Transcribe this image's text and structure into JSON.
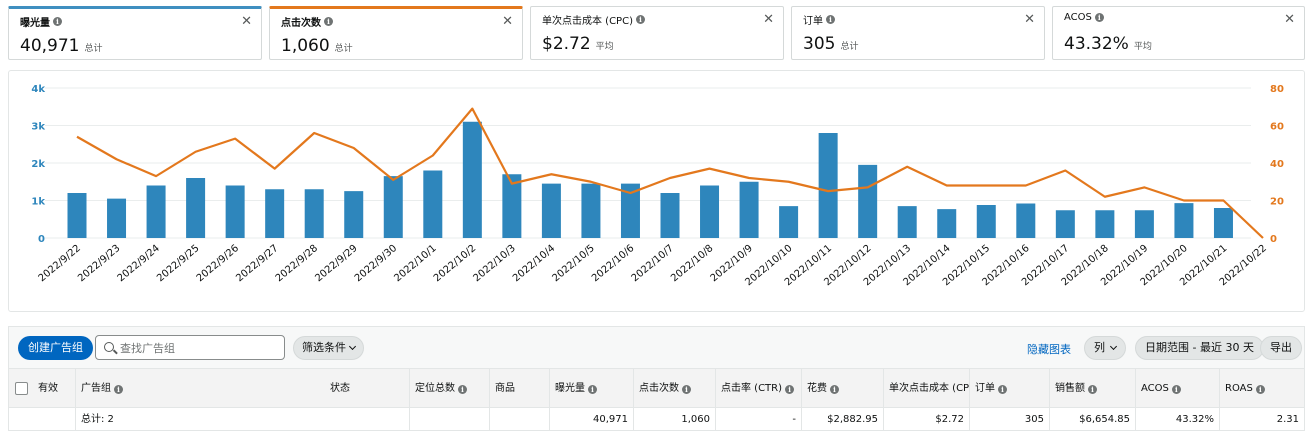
{
  "metric_cards": [
    {
      "title": "曝光量",
      "value": "40,971",
      "sub": "总计",
      "accent": "#3f8fc0"
    },
    {
      "title": "点击次数",
      "value": "1,060",
      "sub": "总计",
      "accent": "#e3781d"
    },
    {
      "title": "单次点击成本 (CPC)",
      "value": "$2.72",
      "sub": "平均"
    },
    {
      "title": "订单",
      "value": "305",
      "sub": "总计"
    },
    {
      "title": "ACOS",
      "value": "43.32%",
      "sub": "平均"
    }
  ],
  "chart_data": {
    "type": "bar",
    "categories": [
      "2022/9/22",
      "2022/9/23",
      "2022/9/24",
      "2022/9/25",
      "2022/9/26",
      "2022/9/27",
      "2022/9/28",
      "2022/9/29",
      "2022/9/30",
      "2022/10/1",
      "2022/10/2",
      "2022/10/3",
      "2022/10/4",
      "2022/10/5",
      "2022/10/6",
      "2022/10/7",
      "2022/10/8",
      "2022/10/9",
      "2022/10/10",
      "2022/10/11",
      "2022/10/12",
      "2022/10/13",
      "2022/10/14",
      "2022/10/15",
      "2022/10/16",
      "2022/10/17",
      "2022/10/18",
      "2022/10/19",
      "2022/10/20",
      "2022/10/21",
      "2022/10/22"
    ],
    "series": [
      {
        "axis": "left",
        "kind": "bar",
        "color": "#2e86bc",
        "values": [
          1200,
          1050,
          1400,
          1600,
          1400,
          1300,
          1300,
          1250,
          1650,
          1800,
          3100,
          1700,
          1450,
          1450,
          1450,
          1200,
          1400,
          1500,
          850,
          2800,
          1950,
          850,
          770,
          880,
          920,
          740,
          740,
          740,
          930,
          800,
          null
        ]
      },
      {
        "axis": "right",
        "kind": "line",
        "color": "#e3781d",
        "values": [
          54,
          42,
          33,
          46,
          53,
          37,
          56,
          48,
          31,
          44,
          69,
          29,
          34,
          30,
          24,
          32,
          37,
          32,
          30,
          25,
          27,
          38,
          28,
          28,
          28,
          36,
          22,
          27,
          20,
          20,
          0
        ]
      }
    ],
    "y_left": {
      "min": 0,
      "max": 4000,
      "ticks": [
        "0",
        "1k",
        "2k",
        "3k",
        "4k"
      ],
      "color": "#2e86bc"
    },
    "y_right": {
      "min": 0,
      "max": 80,
      "ticks": [
        "0",
        "20",
        "40",
        "60",
        "80"
      ],
      "color": "#e3781d"
    }
  },
  "toolbar": {
    "create_label": "创建广告组",
    "search_placeholder": "查找广告组",
    "filter_label": "筛选条件",
    "hide_chart_label": "隐藏图表",
    "columns_label": "列",
    "date_range_label": "日期范围 - 最近 30 天",
    "export_label": "导出"
  },
  "table": {
    "headers": [
      "有效",
      "广告组",
      "状态",
      "定位总数",
      "商品",
      "曝光量",
      "点击次数",
      "点击率 (CTR)",
      "花费",
      "单次点击成本 (CPC)",
      "订单",
      "销售额",
      "ACOS",
      "ROAS"
    ],
    "total_row": {
      "label": "总计: 2",
      "impressions": "40,971",
      "clicks": "1,060",
      "ctr": "-",
      "spend": "$2,882.95",
      "cpc": "$2.72",
      "orders": "305",
      "sales": "$6,654.85",
      "acos": "43.32%",
      "roas": "2.31"
    }
  }
}
